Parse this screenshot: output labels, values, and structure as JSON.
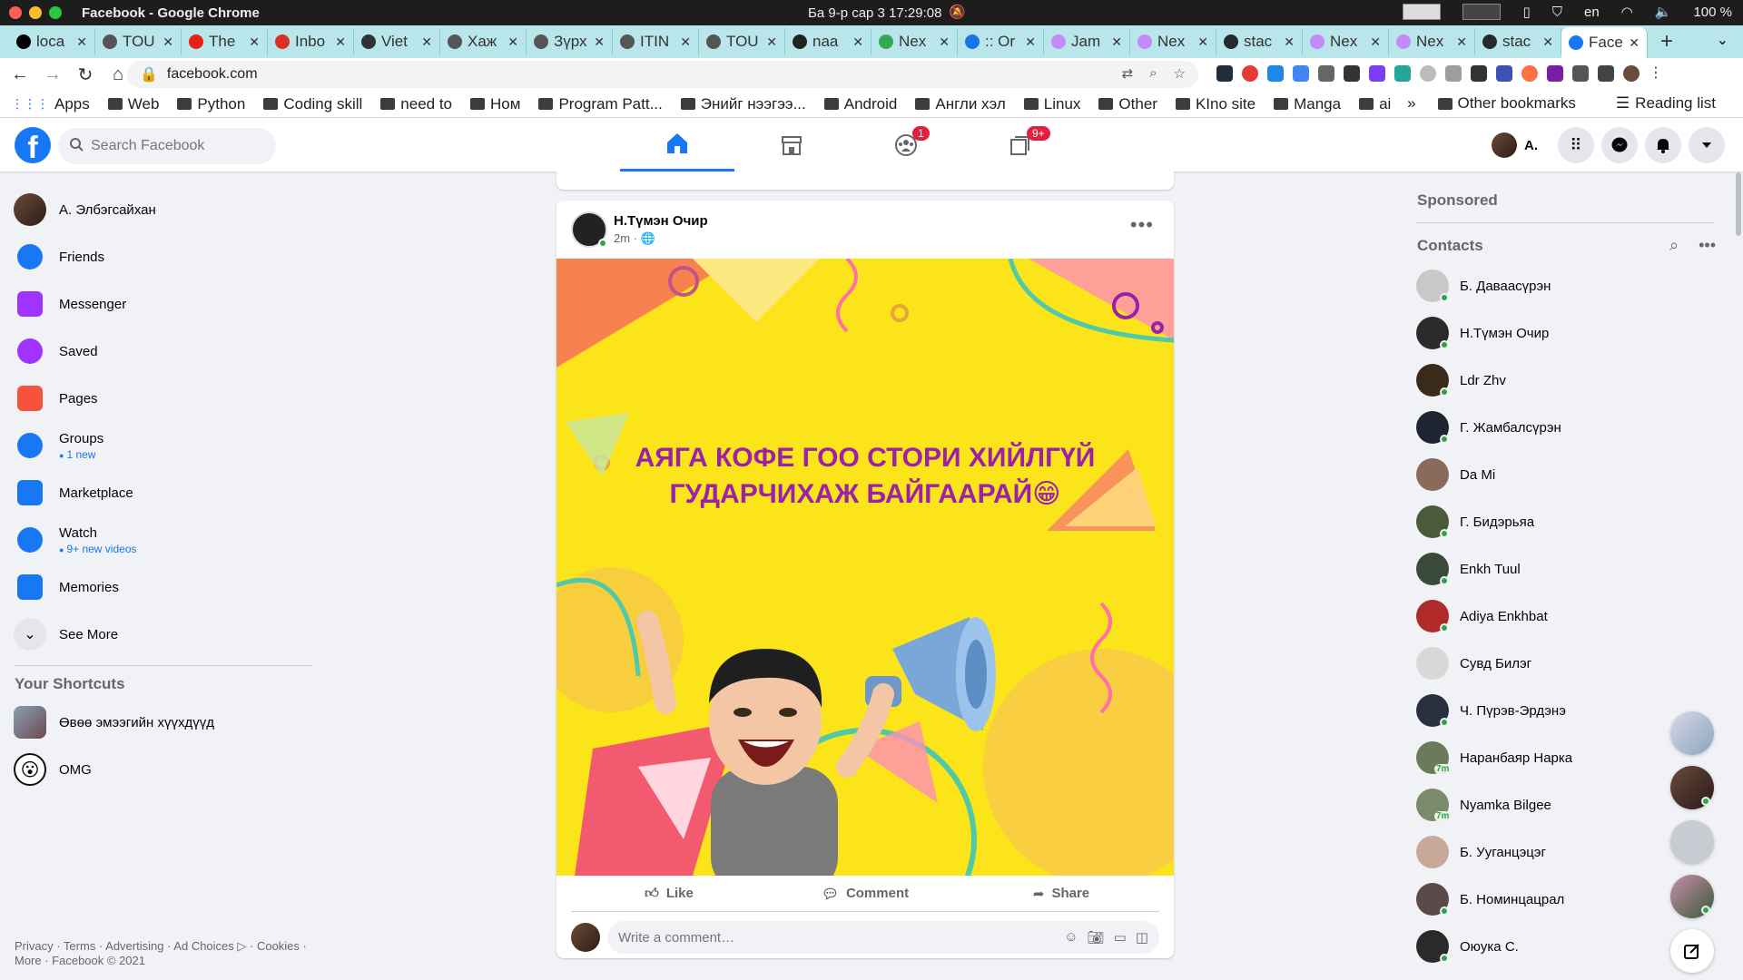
{
  "os": {
    "window_title": "Facebook - Google Chrome",
    "clock": "Ба 9-р сар 3  17:29:08",
    "lang": "en",
    "battery": "100 %"
  },
  "tabs": [
    {
      "label": "loca",
      "color": "#000000"
    },
    {
      "label": "TOU",
      "color": "#555555"
    },
    {
      "label": "The",
      "color": "#e62117"
    },
    {
      "label": "Inbo",
      "color": "#d93025"
    },
    {
      "label": "Viet",
      "color": "#333333"
    },
    {
      "label": "Хаж",
      "color": "#555555"
    },
    {
      "label": "Зүрх",
      "color": "#555555"
    },
    {
      "label": "ITIN",
      "color": "#555555"
    },
    {
      "label": "TOU",
      "color": "#555555"
    },
    {
      "label": "naa",
      "color": "#222222"
    },
    {
      "label": "Nex",
      "color": "#34a853"
    },
    {
      "label": ":: Or",
      "color": "#1a73e8"
    },
    {
      "label": "Jam",
      "color": "#c58af9"
    },
    {
      "label": "Nex",
      "color": "#c58af9"
    },
    {
      "label": "stac",
      "color": "#24292e"
    },
    {
      "label": "Nex",
      "color": "#c58af9"
    },
    {
      "label": "Nex",
      "color": "#c58af9"
    },
    {
      "label": "stac",
      "color": "#24292e"
    },
    {
      "label": "Face",
      "color": "#1877f2",
      "active": true
    }
  ],
  "address": {
    "url": "facebook.com"
  },
  "bookmarks": {
    "apps": "Apps",
    "items": [
      "Web",
      "Python",
      "Coding skill",
      "need to",
      "Ном",
      "Program Patt...",
      "Энийг нээгээ...",
      "Android",
      "Англи хэл",
      "Linux",
      "Other",
      "KIno site",
      "Manga",
      "ai"
    ],
    "overflow": "»",
    "other": "Other bookmarks",
    "reading": "Reading list"
  },
  "fb": {
    "search_placeholder": "Search Facebook",
    "nav": [
      {
        "name": "home",
        "badge": ""
      },
      {
        "name": "marketplace",
        "badge": ""
      },
      {
        "name": "groups",
        "badge": "1"
      },
      {
        "name": "gaming",
        "badge": "9+"
      }
    ],
    "me_name": "А."
  },
  "left": {
    "items": [
      {
        "label": "А. Элбэгсайхан",
        "sub": "",
        "icon": "avatar-icon",
        "color": "#6b4a3a"
      },
      {
        "label": "Friends",
        "sub": "",
        "icon": "friends-icon",
        "color": "#1877f2"
      },
      {
        "label": "Messenger",
        "sub": "",
        "icon": "messenger-icon",
        "color": "#a033ff"
      },
      {
        "label": "Saved",
        "sub": "",
        "icon": "bookmark-icon",
        "color": "#a033ff"
      },
      {
        "label": "Pages",
        "sub": "",
        "icon": "flag-icon",
        "color": "#f5533d"
      },
      {
        "label": "Groups",
        "sub": "1 new",
        "icon": "groups-icon",
        "color": "#1877f2"
      },
      {
        "label": "Marketplace",
        "sub": "",
        "icon": "shop-icon",
        "color": "#1877f2"
      },
      {
        "label": "Watch",
        "sub": "9+ new videos",
        "icon": "watch-icon",
        "color": "#1877f2"
      },
      {
        "label": "Memories",
        "sub": "",
        "icon": "clock-icon",
        "color": "#1877f2"
      },
      {
        "label": "See More",
        "sub": "",
        "icon": "chevron-down-icon",
        "color": "#050505"
      }
    ],
    "shortcuts_heading": "Your Shortcuts",
    "shortcuts": [
      {
        "label": "Өвөө эмээгийн хүүхдүүд"
      },
      {
        "label": "OMG"
      }
    ],
    "footer_line1": "Privacy · Terms · Advertising · Ad Choices ▷ · Cookies ·",
    "footer_line2": "More · Facebook © 2021"
  },
  "post": {
    "author": "Н.Түмэн Очир",
    "time": "2m ·",
    "caption_line1": "АЯГА КОФЕ ГОО СТОРИ ХИЙЛГҮЙ",
    "caption_line2": "ГУДАРЧИХАЖ БАЙГААРАЙ😁",
    "like": "Like",
    "comment": "Comment",
    "share": "Share",
    "comment_placeholder": "Write a comment…"
  },
  "right": {
    "sponsored": "Sponsored",
    "contacts_heading": "Contacts",
    "contacts": [
      {
        "name": "Б. Даваасүрэн",
        "status": "online",
        "color": "#c8c8c8"
      },
      {
        "name": "Н.Түмэн Очир",
        "status": "online",
        "color": "#2b2b2b"
      },
      {
        "name": "Ldr Zhv",
        "status": "online",
        "color": "#3a2a1a"
      },
      {
        "name": "Г. Жамбалсүрэн",
        "status": "online",
        "color": "#1e2430"
      },
      {
        "name": "Da Mi",
        "status": "",
        "color": "#8a6a5a"
      },
      {
        "name": "Г. Бидэрьяа",
        "status": "online",
        "color": "#4a5a3a"
      },
      {
        "name": "Enkh Tuul",
        "status": "online",
        "color": "#3a4a3a"
      },
      {
        "name": "Adiya Enkhbat",
        "status": "online",
        "color": "#b02a2a"
      },
      {
        "name": "Сувд Билэг",
        "status": "",
        "color": "#d8d8d8"
      },
      {
        "name": "Ч. Пүрэв-Эрдэнэ",
        "status": "online",
        "color": "#2a3040"
      },
      {
        "name": "Наранбаяр Нарка",
        "status": "7m",
        "color": "#6a7a5a"
      },
      {
        "name": "Nyamka Bilgee",
        "status": "7m",
        "color": "#7a8a6a"
      },
      {
        "name": "Б. Ууганцэцэг",
        "status": "",
        "color": "#c8a898"
      },
      {
        "name": "Б. Номинцацрал",
        "status": "online",
        "color": "#5a4a4a"
      },
      {
        "name": "Оюука С.",
        "status": "online",
        "color": "#2a2a2a"
      }
    ]
  }
}
